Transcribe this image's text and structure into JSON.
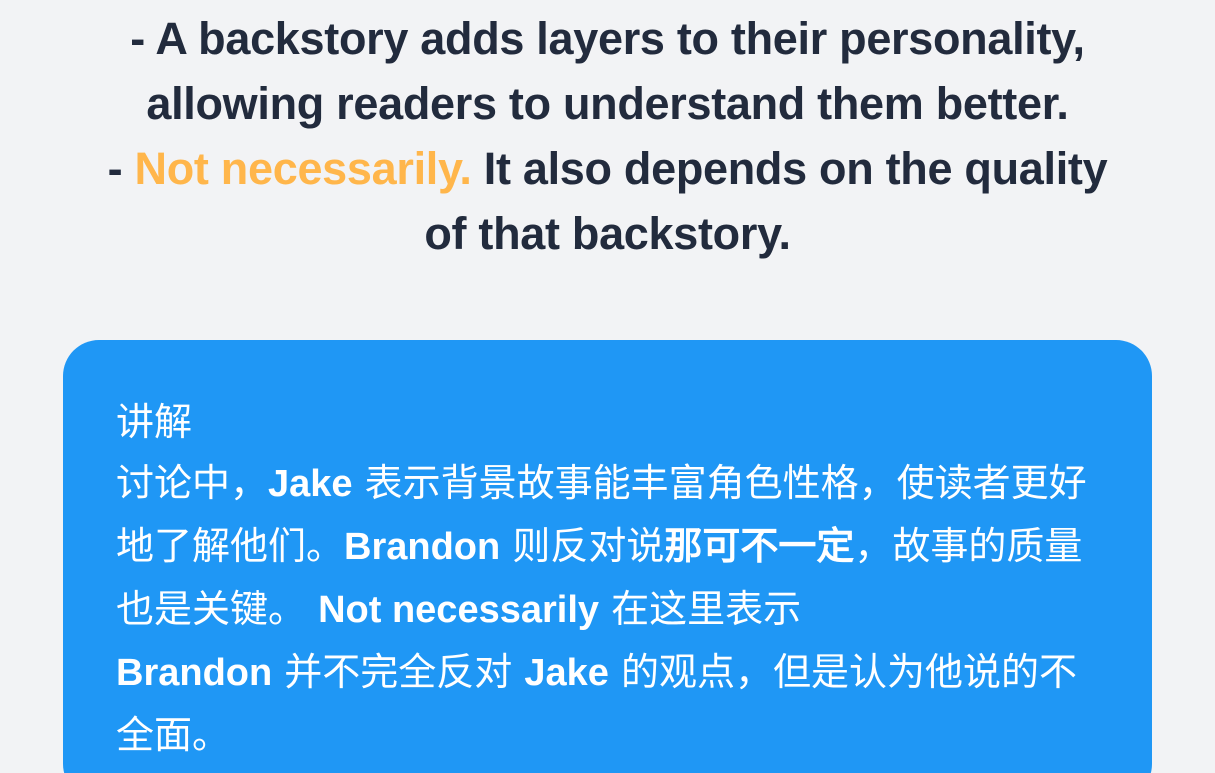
{
  "dialogue": {
    "line1": "- A backstory adds layers to their personality,",
    "line2": "allowing readers to understand them better.",
    "line3_prefix": "- ",
    "line3_highlight": "Not necessarily.",
    "line3_rest": " It also depends on the quality",
    "line4": "of that backstory."
  },
  "explanation": {
    "title": "讲解",
    "p1": "讨论中，",
    "p2": "Jake",
    "p3": " 表示背景故事能丰富角色性格，使读者更好地了解他们。",
    "p4": "Brandon",
    "p5": " 则反对说",
    "p6": "那可不一定",
    "p7": "，故事的质量也是关键。 ",
    "p8": "Not necessarily",
    "p9": " 在这里表示",
    "p10": "Brandon",
    "p11": " 并不完全反对 ",
    "p12": "Jake",
    "p13": " 的观点，但是认为他说的不全面。"
  },
  "colors": {
    "background": "#f2f3f5",
    "text": "#222b3d",
    "highlight": "#ffb64b",
    "card": "#1f97f5"
  }
}
